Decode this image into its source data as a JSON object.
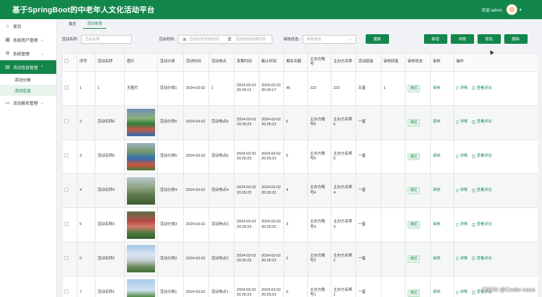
{
  "app": {
    "title": "基于SpringBoot的中老年人文化活动平台",
    "welcome": "欢迎 admin"
  },
  "sidebar": {
    "items": [
      {
        "label": "首页",
        "icon": "home-icon"
      },
      {
        "label": "系统用户管理",
        "icon": "grid-icon"
      },
      {
        "label": "系统管理",
        "icon": "gear-icon"
      },
      {
        "label": "活动信息管理",
        "icon": "doc-icon"
      },
      {
        "label": "活动报名管理",
        "icon": "folder-icon"
      }
    ],
    "sub_items": [
      "活动分类",
      "活动信息"
    ]
  },
  "tabs": [
    "首页",
    "活动信息"
  ],
  "filter": {
    "name_label": "活动名称:",
    "name_placeholder": "活动名称",
    "time_label": "活动时间:",
    "start_placeholder": "活动时间开始时间",
    "to": "至",
    "end_placeholder": "活动时间结束时间",
    "status_label": "审核状态:",
    "status_placeholder": "审核状态",
    "search": "搜索"
  },
  "actions": {
    "add": "新增",
    "detail": "详情",
    "edit": "修改",
    "delete": "删除"
  },
  "table": {
    "headers": [
      "序号",
      "活动名称",
      "图片",
      "活动分类",
      "活动时间",
      "活动地点",
      "发案时间",
      "截止时间",
      "报名名额",
      "主办方账号",
      "主办方名称",
      "活动层级",
      "审核回复",
      "审核状态",
      "审核",
      "操作"
    ],
    "rows": [
      {
        "no": "1",
        "name": "1",
        "image": "无图片",
        "category": "活动分类1",
        "time": "2024-03-02",
        "place": "1",
        "publish": "2024-03-02 20:34:12",
        "deadline": "2024-03-02 20:34:17",
        "quota": "45",
        "org_account": "222",
        "org_name": "222",
        "level": "五星",
        "reply": "1",
        "status": "通过",
        "audit": "审核"
      },
      {
        "no": "2",
        "name": "活动名称6",
        "image": "",
        "category": "活动分类6",
        "time": "2024-03-02",
        "place": "活动地点6",
        "publish": "2024-03-02 20:26:23",
        "deadline": "2024-03-02 20:26:23",
        "quota": "6",
        "org_account": "主办方账号6",
        "org_name": "主办方名称6",
        "level": "一星",
        "reply": "",
        "status": "通过",
        "audit": "审核"
      },
      {
        "no": "3",
        "name": "活动名称5",
        "image": "",
        "category": "活动分类5",
        "time": "2024-03-02",
        "place": "活动地点5",
        "publish": "2024-03-02 20:26:23",
        "deadline": "2024-03-02 20:26:23",
        "quota": "5",
        "org_account": "主办方账号5",
        "org_name": "主办方名称5",
        "level": "一星",
        "reply": "",
        "status": "通过",
        "audit": "审核"
      },
      {
        "no": "4",
        "name": "活动名称4",
        "image": "",
        "category": "活动分类4",
        "time": "2024-03-02",
        "place": "活动地点4",
        "publish": "2024-03-02 20:26:23",
        "deadline": "2024-03-02 20:26:23",
        "quota": "4",
        "org_account": "主办方账号4",
        "org_name": "主办方名称4",
        "level": "一星",
        "reply": "",
        "status": "通过",
        "audit": "审核"
      },
      {
        "no": "5",
        "name": "活动名称3",
        "image": "",
        "category": "活动分类3",
        "time": "2024-03-02",
        "place": "活动地点3",
        "publish": "2024-03-02 20:26:23",
        "deadline": "2024-03-02 20:26:23",
        "quota": "3",
        "org_account": "主办方账号3",
        "org_name": "主办方名称3",
        "level": "一星",
        "reply": "",
        "status": "通过",
        "audit": "审核"
      },
      {
        "no": "6",
        "name": "活动名称2",
        "image": "",
        "category": "活动分类2",
        "time": "2024-03-02",
        "place": "活动地点2",
        "publish": "2024-03-02 20:26:23",
        "deadline": "2024-03-02 20:26:23",
        "quota": "2",
        "org_account": "主办方账号2",
        "org_name": "主办方名称2",
        "level": "一星",
        "reply": "",
        "status": "通过",
        "audit": "审核"
      },
      {
        "no": "7",
        "name": "活动名称1",
        "image": "",
        "category": "活动分类1",
        "time": "2024-03-02",
        "place": "活动地点1",
        "publish": "2024-03-02 20:26:23",
        "deadline": "2024-03-02 20:26:23",
        "quota": "0",
        "org_account": "主办方账号1",
        "org_name": "主办方名称1",
        "level": "一星",
        "reply": "",
        "status": "通过",
        "audit": "审核"
      }
    ],
    "op_detail": "详情",
    "op_comments": "查看评论"
  },
  "watermark": "CSDN @Coder-coco",
  "colors": {
    "brand": "#13864c",
    "badge_bg": "#e1f3e8"
  }
}
